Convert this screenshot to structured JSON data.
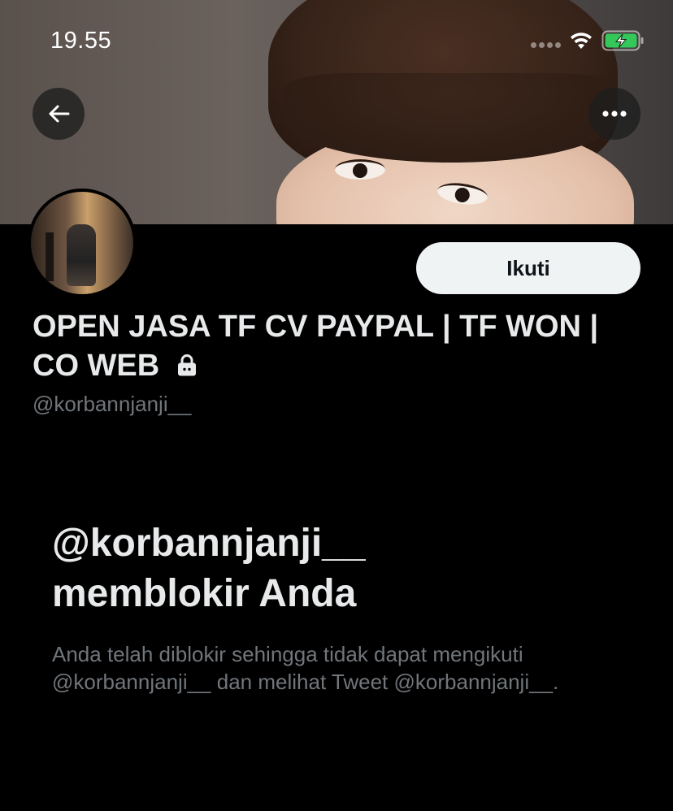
{
  "status_bar": {
    "time": "19.55"
  },
  "header": {
    "back_icon": "arrow-left-icon",
    "more_icon": "more-horizontal-icon"
  },
  "profile": {
    "follow_label": "Ikuti",
    "display_name": "OPEN JASA TF CV PAYPAL | TF WON | CO WEB",
    "protected_icon": "lock-icon",
    "handle": "@korbannjanji__"
  },
  "blocked": {
    "title_line1": "@korbannjanji__",
    "title_line2": "memblokir Anda",
    "description": "Anda telah diblokir sehingga tidak dapat mengikuti @korbannjanji__ dan melihat Tweet @korbannjanji__."
  },
  "colors": {
    "background": "#000000",
    "text_primary": "#e7e9ea",
    "text_secondary": "#71767b",
    "follow_button_bg": "#eff3f4",
    "battery_charging": "#34c759"
  }
}
